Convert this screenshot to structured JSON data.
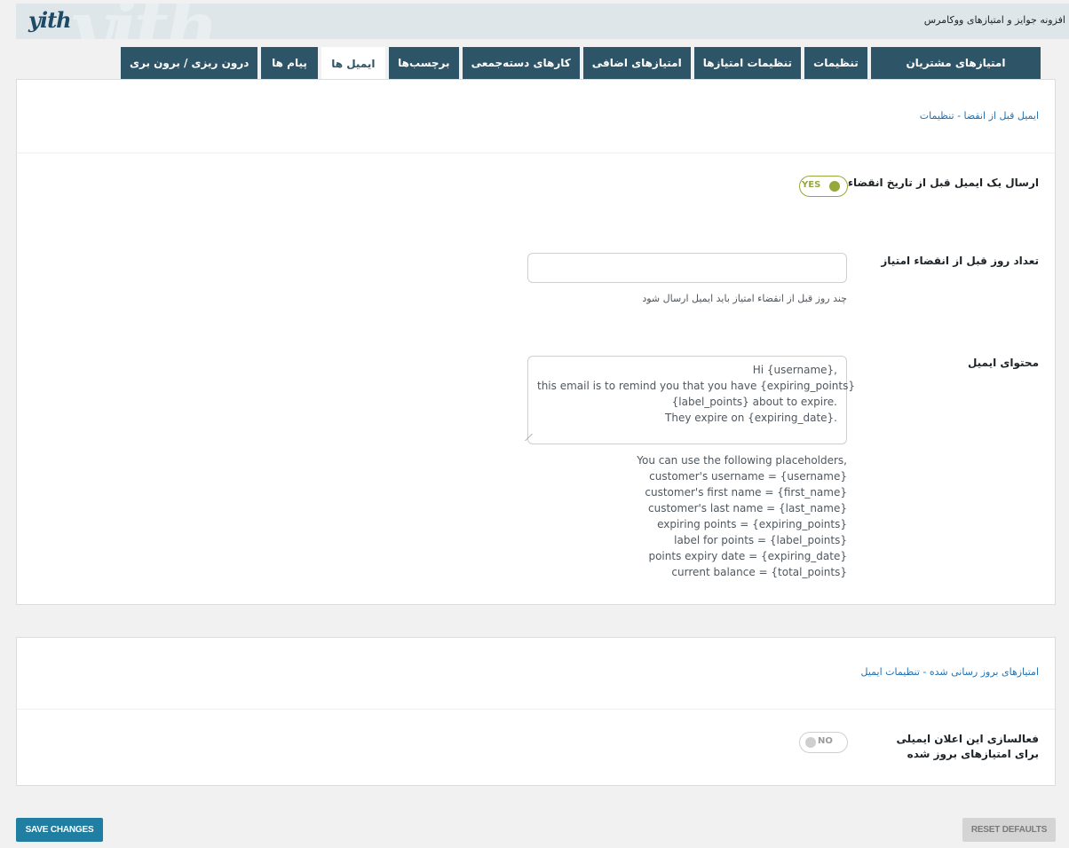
{
  "header": {
    "logo": "yith",
    "plugin_title": "افزونه جوایز و امتیازهای ووکامرس"
  },
  "tabs": [
    {
      "label": "امتیازهای مشتریان",
      "active": false
    },
    {
      "label": "تنظیمات",
      "active": false
    },
    {
      "label": "تنظیمات امتیازها",
      "active": false
    },
    {
      "label": "امتیازهای اضافی",
      "active": false
    },
    {
      "label": "کارهای دسته‌جمعی",
      "active": false
    },
    {
      "label": "برچسب‌ها",
      "active": false
    },
    {
      "label": "ایمیل ها",
      "active": true
    },
    {
      "label": "پیام ها",
      "active": false
    },
    {
      "label": "درون ریزی / برون بری",
      "active": false
    }
  ],
  "section1": {
    "heading": "ایمیل قبل از انقضا - تنظیمات",
    "send_email": {
      "label": "ارسال یک ایمیل قبل از تاریخ انقضاء",
      "state": "YES"
    },
    "days": {
      "label": "تعداد روز قبل از انقضاء امتیاز",
      "value": "",
      "description": "چند روز قبل از انقضاء امتیاز باید ایمیل ارسال شود"
    },
    "content": {
      "label": "محتوای ایمیل",
      "lines": [
        "Hi {username},",
        "this email is to remind you that you have {expiring_points}",
        "{label_points} about to expire.",
        "They expire on {expiring_date}."
      ],
      "placeholders": [
        "You can use the following placeholders,",
        "customer's username = {username}",
        "customer's first name = {first_name}",
        "customer's last name = {last_name}",
        "expiring points = {expiring_points}",
        "label for points = {label_points}",
        "points expiry date = {expiring_date}",
        "current balance = {total_points}"
      ]
    }
  },
  "section2": {
    "heading": "امتیازهای بروز رسانی شده - تنظیمات ایمیل",
    "enable": {
      "label": "فعالسازی این اعلان ایمیلی برای امتیازهای بروز شده",
      "state": "NO"
    }
  },
  "buttons": {
    "save": "SAVE CHANGES",
    "reset": "RESET DEFAULTS"
  }
}
